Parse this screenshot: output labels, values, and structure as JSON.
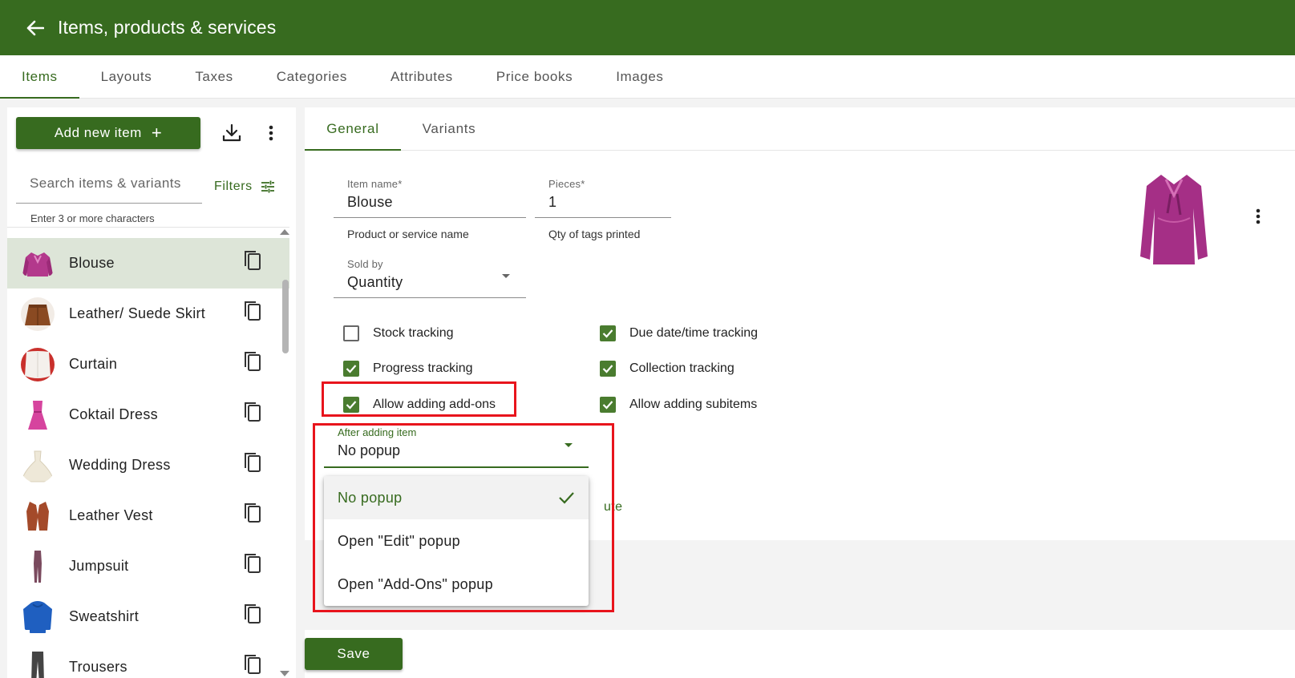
{
  "header": {
    "title": "Items, products & services"
  },
  "top_tabs": [
    {
      "label": "Items",
      "active": true
    },
    {
      "label": "Layouts"
    },
    {
      "label": "Taxes"
    },
    {
      "label": "Categories"
    },
    {
      "label": "Attributes"
    },
    {
      "label": "Price books"
    },
    {
      "label": "Images"
    }
  ],
  "left": {
    "add_button": "Add new item",
    "add_button_icon": "+",
    "search_placeholder": "Search items & variants",
    "search_hint": "Enter 3 or more characters",
    "filters_label": "Filters",
    "items": [
      {
        "label": "Blouse",
        "selected": true
      },
      {
        "label": "Leather/ Suede Skirt"
      },
      {
        "label": "Curtain"
      },
      {
        "label": "Coktail Dress"
      },
      {
        "label": "Wedding Dress"
      },
      {
        "label": "Leather Vest"
      },
      {
        "label": "Jumpsuit"
      },
      {
        "label": "Sweatshirt"
      },
      {
        "label": "Trousers"
      }
    ]
  },
  "sub_tabs": [
    {
      "label": "General",
      "active": true
    },
    {
      "label": "Variants"
    }
  ],
  "form": {
    "item_name_label": "Item name*",
    "item_name_value": "Blouse",
    "item_name_helper": "Product or service name",
    "pieces_label": "Pieces*",
    "pieces_value": "1",
    "pieces_helper": "Qty of tags printed",
    "sold_by_label": "Sold by",
    "sold_by_value": "Quantity",
    "checkboxes": {
      "stock_tracking": {
        "label": "Stock tracking",
        "checked": false
      },
      "due_date_tracking": {
        "label": "Due date/time tracking",
        "checked": true
      },
      "progress_tracking": {
        "label": "Progress tracking",
        "checked": true
      },
      "collection_tracking": {
        "label": "Collection tracking",
        "checked": true
      },
      "allow_addons": {
        "label": "Allow adding add-ons",
        "checked": true
      },
      "allow_subitems": {
        "label": "Allow adding subitems",
        "checked": true
      }
    },
    "after_adding_label": "After adding item",
    "after_adding_value": "No popup",
    "partial_text": "ute",
    "menu_options": [
      {
        "label": "No popup",
        "selected": true
      },
      {
        "label": "Open \"Edit\" popup"
      },
      {
        "label": "Open \"Add-Ons\" popup"
      }
    ],
    "save_label": "Save"
  },
  "colors": {
    "primary": "#376b1f",
    "checkbox": "#4a7c2f",
    "highlight": "#e8141c",
    "selected_row": "#dde5d8"
  }
}
